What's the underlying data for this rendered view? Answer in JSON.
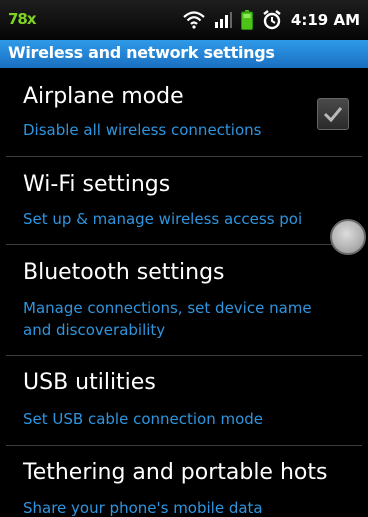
{
  "status_bar": {
    "notification_text": "78x",
    "time": "4:19 AM",
    "icons": [
      "wifi-icon",
      "signal-icon",
      "battery-icon",
      "alarm-icon"
    ],
    "colors": {
      "notification": "#7ed321",
      "battery": "#4cc417"
    }
  },
  "header": {
    "title": "Wireless and network settings",
    "color": "#1f7fd6"
  },
  "items": [
    {
      "title": "Airplane mode",
      "subtitle": "Disable all wireless connections",
      "checkbox": true
    },
    {
      "title": "Wi-Fi settings",
      "subtitle": "Set up & manage wireless access poi"
    },
    {
      "title": "Bluetooth settings",
      "subtitle": "Manage connections, set device name",
      "subtitle2": "and discoverability"
    },
    {
      "title": "USB utilities",
      "subtitle": "Set USB cable connection mode"
    },
    {
      "title": "Tethering and portable hots",
      "subtitle": "Share your phone's mobile data"
    }
  ],
  "accent_color": "#2f95df"
}
